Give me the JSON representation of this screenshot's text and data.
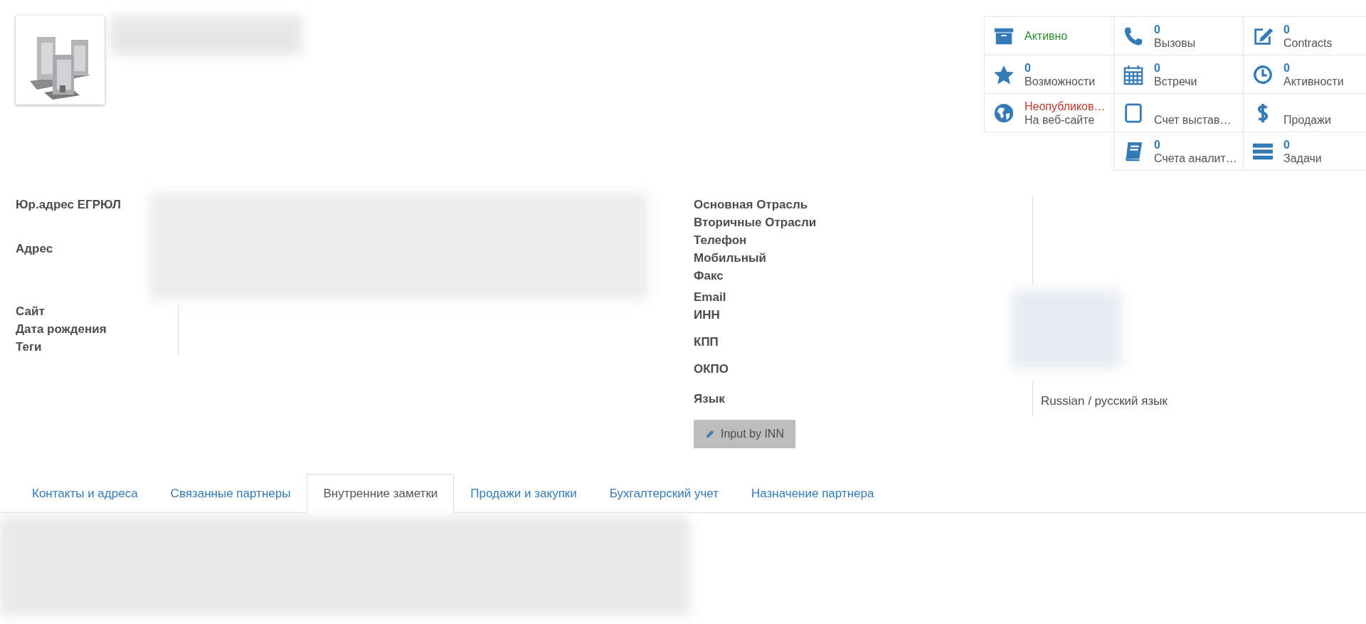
{
  "stat_buttons": [
    [
      {
        "kind": "toggle",
        "label": "Активно",
        "on": true
      },
      {
        "kind": "stat",
        "count": "0",
        "label": "Вызовы"
      },
      {
        "kind": "stat",
        "count": "0",
        "label": "Contracts"
      }
    ],
    [
      {
        "kind": "stat",
        "count": "0",
        "label": "Возможности"
      },
      {
        "kind": "stat",
        "count": "0",
        "label": "Встречи"
      },
      {
        "kind": "stat",
        "count": "0",
        "label": "Активности"
      }
    ],
    [
      {
        "kind": "toggle",
        "label": "Неопубликов…",
        "sublabel": "На веб-сайте",
        "on": false
      },
      {
        "kind": "stat",
        "label": "Счет выстав…"
      },
      {
        "kind": "stat",
        "label": "Продажи"
      }
    ],
    [
      {
        "kind": "stat",
        "count": "0",
        "label": "Счета аналит…"
      },
      {
        "kind": "stat",
        "count": "0",
        "label": "Задачи"
      }
    ]
  ],
  "left_fields": [
    {
      "label": "Юр.адрес ЕГРЮЛ"
    },
    {
      "label": "Адрес"
    },
    {
      "label": "Сайт"
    },
    {
      "label": "Дата рождения"
    },
    {
      "label": "Теги"
    }
  ],
  "right_fields": [
    {
      "label": "Основная Отрасль"
    },
    {
      "label": "Вторичные Отрасли"
    },
    {
      "label": "Телефон"
    },
    {
      "label": "Мобильный"
    },
    {
      "label": "Факс"
    },
    {
      "label": "Email"
    },
    {
      "label": "ИНН"
    },
    {
      "label": "КПП"
    },
    {
      "label": "ОКПО"
    },
    {
      "label": "Язык",
      "value": "Russian / русский язык"
    }
  ],
  "inn_button": "Input by INN",
  "tabs": [
    {
      "label": "Контакты и адреса",
      "selected": false
    },
    {
      "label": "Связанные партнеры",
      "selected": false
    },
    {
      "label": "Внутренние заметки",
      "selected": true
    },
    {
      "label": "Продажи и закупки",
      "selected": false
    },
    {
      "label": "Бухгалтерский учет",
      "selected": false
    },
    {
      "label": "Назначение партнера",
      "selected": false
    }
  ]
}
